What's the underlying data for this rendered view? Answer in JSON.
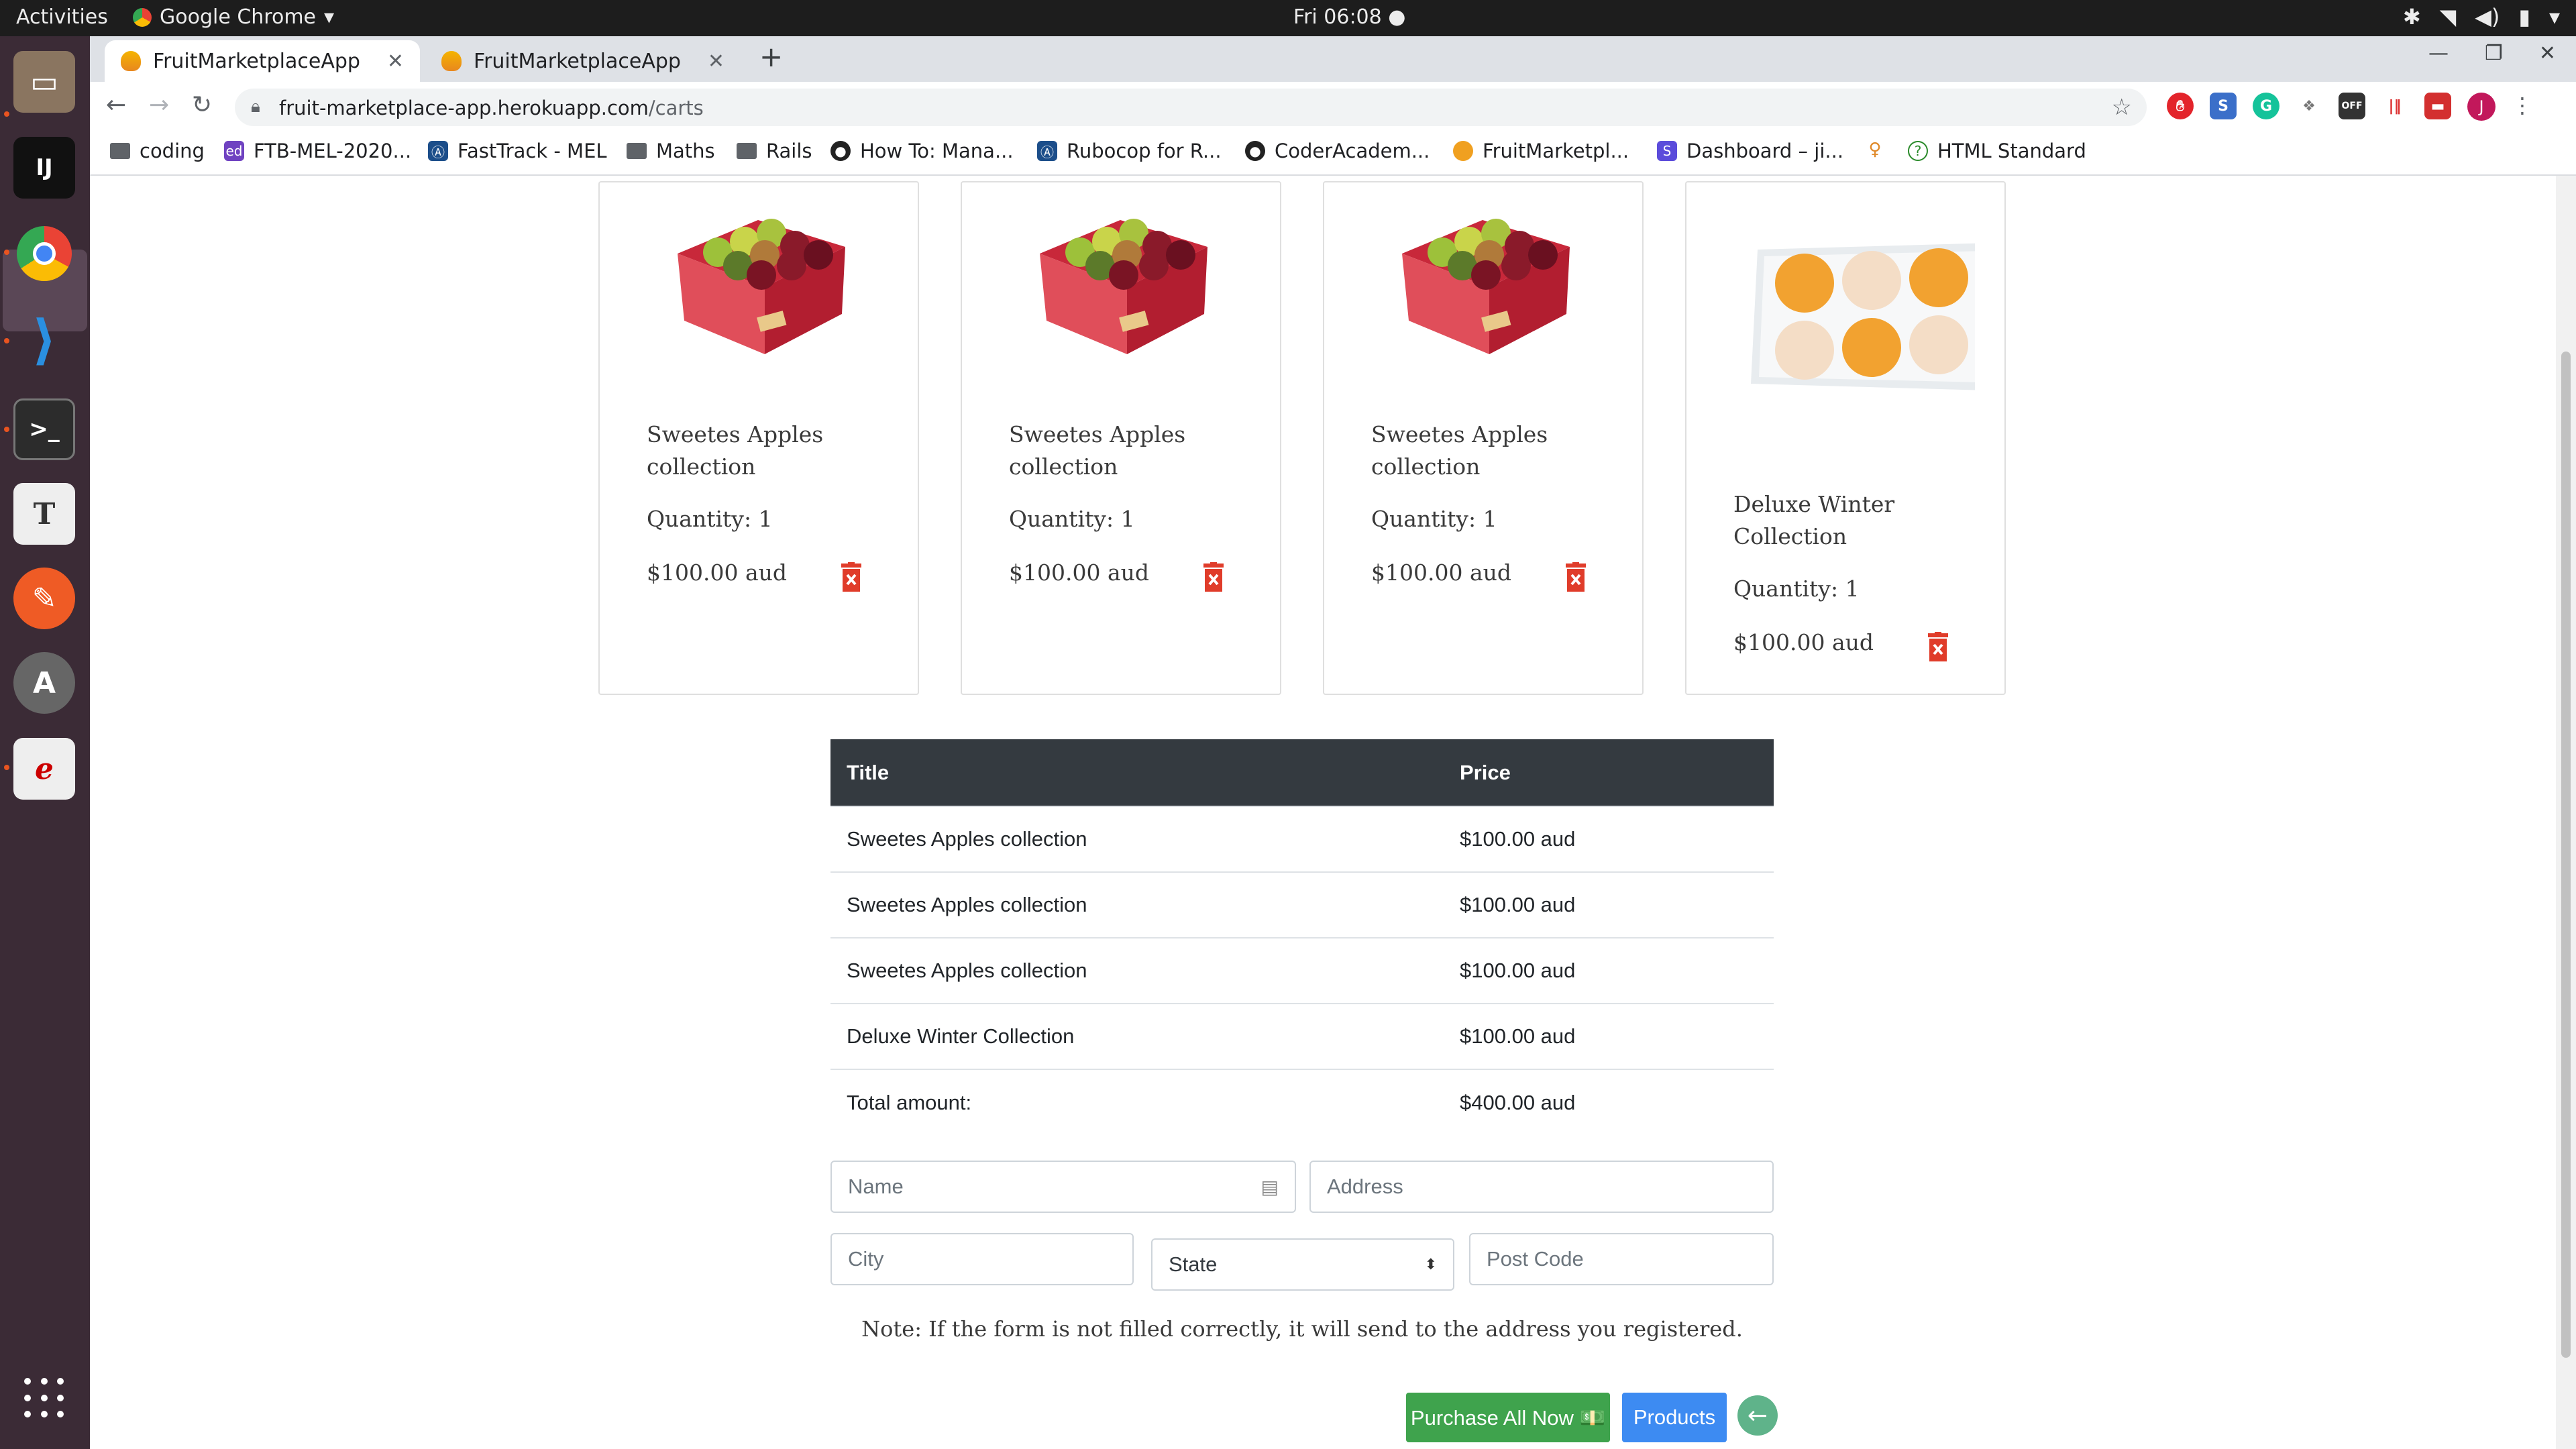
{
  "system_bar": {
    "activities": "Activities",
    "app_name": "Google Chrome",
    "clock": "Fri 06:08"
  },
  "browser": {
    "tabs": [
      {
        "label": "FruitMarketplaceApp",
        "active": true
      },
      {
        "label": "FruitMarketplaceApp",
        "active": false
      }
    ],
    "url_host": "fruit-marketplace-app.herokuapp.com",
    "url_path": "/carts",
    "bookmarks": [
      {
        "label": "coding",
        "icon": "folder-icon"
      },
      {
        "label": "FTB-MEL-2020...",
        "icon": "ed-icon"
      },
      {
        "label": "FastTrack - MEL",
        "icon": "ca-icon"
      },
      {
        "label": "Maths",
        "icon": "folder-icon"
      },
      {
        "label": "Rails",
        "icon": "folder-icon"
      },
      {
        "label": "How To: Mana...",
        "icon": "github-icon"
      },
      {
        "label": "Rubocop for R...",
        "icon": "ca-icon"
      },
      {
        "label": "CoderAcadem...",
        "icon": "github-icon"
      },
      {
        "label": "FruitMarketpl...",
        "icon": "fruit-icon"
      },
      {
        "label": "Dashboard – ji...",
        "icon": "s-icon"
      },
      {
        "label": "",
        "icon": "person-icon"
      },
      {
        "label": "HTML Standard",
        "icon": "help-icon"
      }
    ],
    "avatar_letter": "J"
  },
  "cart_cards": [
    {
      "title": "Sweetes Apples collection",
      "quantity": "Quantity: 1",
      "price": "$100.00 aud",
      "image": "apple-box-image"
    },
    {
      "title": "Sweetes Apples collection",
      "quantity": "Quantity: 1",
      "price": "$100.00 aud",
      "image": "apple-box-image"
    },
    {
      "title": "Sweetes Apples collection",
      "quantity": "Quantity: 1",
      "price": "$100.00 aud",
      "image": "apple-box-image"
    },
    {
      "title": "Deluxe Winter Collection",
      "quantity": "Quantity: 1",
      "price": "$100.00 aud",
      "image": "pear-box-image"
    }
  ],
  "summary_table": {
    "headers": [
      "Title",
      "Price"
    ],
    "rows": [
      [
        "Sweetes Apples collection",
        "$100.00 aud"
      ],
      [
        "Sweetes Apples collection",
        "$100.00 aud"
      ],
      [
        "Sweetes Apples collection",
        "$100.00 aud"
      ],
      [
        "Deluxe Winter Collection",
        "$100.00 aud"
      ],
      [
        "Total amount:",
        "$400.00 aud"
      ]
    ]
  },
  "form": {
    "name_placeholder": "Name",
    "address_placeholder": "Address",
    "city_placeholder": "City",
    "state_selected": "State",
    "postcode_placeholder": "Post Code",
    "note": "Note: If the form is not filled correctly, it will send to the address you registered."
  },
  "actions": {
    "purchase_label": "Purchase All Now 💵",
    "products_label": "Products"
  },
  "colors": {
    "table_header": "#343a40",
    "purchase_button": "#3fa34d",
    "products_button": "#3d8bf2",
    "delete_icon": "#e03c2a"
  }
}
